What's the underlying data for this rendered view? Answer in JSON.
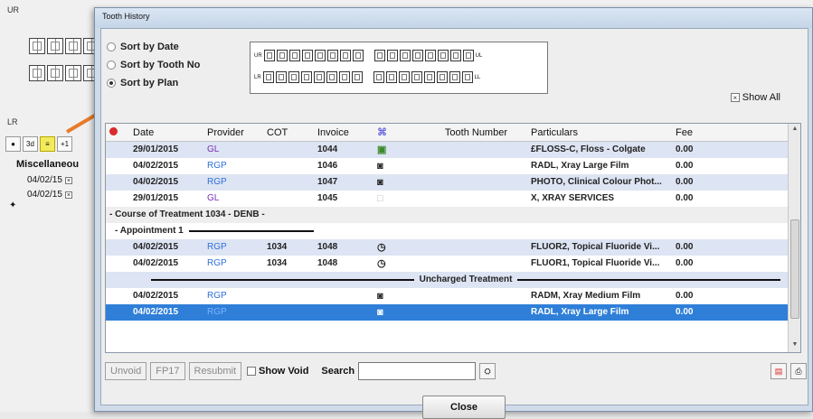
{
  "background": {
    "ur_label": "UR",
    "lr_label": "LR",
    "buttons": [
      "●",
      "3d",
      "≡",
      "+1"
    ],
    "heading": "Miscellaneou",
    "rows": [
      {
        "date": "04/02/15"
      },
      {
        "date": "04/02/15"
      }
    ]
  },
  "dialog": {
    "title": "Tooth History",
    "sort_options": [
      {
        "label": "Sort by Date",
        "selected": false
      },
      {
        "label": "Sort by Tooth No",
        "selected": false
      },
      {
        "label": "Sort by Plan",
        "selected": true
      }
    ],
    "chart_labels": {
      "ur": "UR",
      "ul": "UL",
      "lr": "LR",
      "ll": "LL"
    },
    "show_all_label": "Show All",
    "show_all_checked": true,
    "columns": [
      "Date",
      "Provider",
      "COT",
      "Invoice",
      "",
      "Tooth Number",
      "Particulars",
      "Fee"
    ],
    "rows_top": [
      {
        "date": "29/01/2015",
        "provider": "GL",
        "cot": "",
        "invoice": "1044",
        "particulars": "£FLOSS-C, Floss - Colgate",
        "fee": "0.00",
        "icon": "product-icon"
      },
      {
        "date": "04/02/2015",
        "provider": "RGP",
        "cot": "",
        "invoice": "1046",
        "particulars": "RADL, Xray Large Film",
        "fee": "0.00",
        "icon": "camera-icon"
      },
      {
        "date": "04/02/2015",
        "provider": "RGP",
        "cot": "",
        "invoice": "1047",
        "particulars": "PHOTO, Clinical Colour Phot...",
        "fee": "0.00",
        "icon": "camera-icon"
      },
      {
        "date": "29/01/2015",
        "provider": "GL",
        "cot": "",
        "invoice": "1045",
        "particulars": "X, XRAY SERVICES",
        "fee": "0.00",
        "icon": "blank-icon"
      }
    ],
    "course_label": "- Course of Treatment 1034 - DENB -",
    "appointment_label": "- Appointment 1",
    "rows_appt": [
      {
        "date": "04/02/2015",
        "provider": "RGP",
        "cot": "1034",
        "invoice": "1048",
        "particulars": "FLUOR2, Topical Fluoride Vi...",
        "fee": "0.00",
        "icon": "timer-icon"
      },
      {
        "date": "04/02/2015",
        "provider": "RGP",
        "cot": "1034",
        "invoice": "1048",
        "particulars": "FLUOR1, Topical Fluoride Vi...",
        "fee": "0.00",
        "icon": "timer-icon"
      }
    ],
    "uncharged_label": "Uncharged Treatment",
    "rows_unch": [
      {
        "date": "04/02/2015",
        "provider": "RGP",
        "cot": "",
        "invoice": "",
        "particulars": "RADM, Xray Medium Film",
        "fee": "0.00",
        "icon": "camera-icon"
      },
      {
        "date": "04/02/2015",
        "provider": "RGP",
        "cot": "",
        "invoice": "",
        "particulars": "RADL, Xray Large Film",
        "fee": "0.00",
        "icon": "camera-icon"
      }
    ],
    "unvoid_label": "Unvoid",
    "fp17_label": "FP17",
    "resubmit_label": "Resubmit",
    "show_void_label": "Show Void",
    "search_label": "Search",
    "search_value": "",
    "close_label": "Close"
  }
}
